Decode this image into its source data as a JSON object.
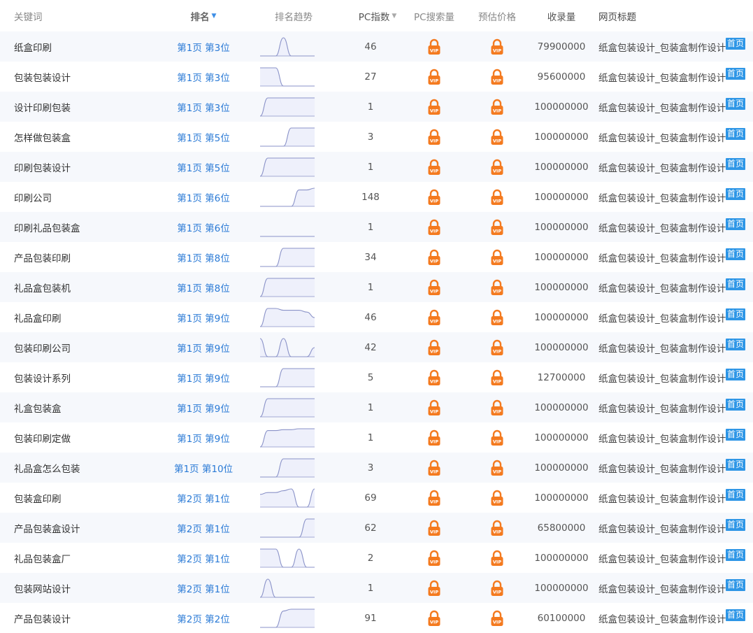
{
  "header": {
    "keyword": "关键词",
    "rank": "排名",
    "trend": "排名趋势",
    "pc_index": "PC指数",
    "pc_search": "PC搜索量",
    "price": "预估价格",
    "indexed": "收录量",
    "page_title": "网页标题"
  },
  "colors": {
    "link": "#2a7ad6",
    "badge": "#2e96e6",
    "trend_line": "#8a92c8",
    "trend_fill": "#eef0fb",
    "lock": "#f47a1f"
  },
  "badge_label": "首页",
  "title_text": "纸盒包装设计_包装盒制作设计",
  "rows": [
    {
      "keyword": "纸盒印刷",
      "rank": "第1页 第3位",
      "pc": "46",
      "indexed": "79900000",
      "trend": [
        0,
        0,
        0,
        1,
        0,
        0,
        0,
        0
      ]
    },
    {
      "keyword": "包装包装设计",
      "rank": "第1页 第3位",
      "pc": "27",
      "indexed": "95600000",
      "trend": [
        1,
        1,
        1,
        0,
        0,
        0,
        0,
        0
      ]
    },
    {
      "keyword": "设计印刷包装",
      "rank": "第1页 第3位",
      "pc": "1",
      "indexed": "100000000",
      "trend": [
        0,
        1,
        1,
        1,
        1,
        1,
        1,
        1
      ]
    },
    {
      "keyword": "怎样做包装盒",
      "rank": "第1页 第5位",
      "pc": "3",
      "indexed": "100000000",
      "trend": [
        0,
        0,
        0,
        0,
        1,
        1,
        1,
        1
      ]
    },
    {
      "keyword": "印刷包装设计",
      "rank": "第1页 第5位",
      "pc": "1",
      "indexed": "100000000",
      "trend": [
        0,
        1,
        1,
        1,
        1,
        1,
        1,
        1
      ]
    },
    {
      "keyword": "印刷公司",
      "rank": "第1页 第6位",
      "pc": "148",
      "indexed": "100000000",
      "trend": [
        0,
        0,
        0,
        0,
        0,
        0.9,
        0.9,
        1
      ]
    },
    {
      "keyword": "印刷礼品包装盒",
      "rank": "第1页 第6位",
      "pc": "1",
      "indexed": "100000000",
      "trend": [
        0,
        0,
        0,
        0,
        0,
        0,
        0,
        0
      ]
    },
    {
      "keyword": "产品包装印刷",
      "rank": "第1页 第8位",
      "pc": "34",
      "indexed": "100000000",
      "trend": [
        0,
        0,
        0,
        1,
        1,
        1,
        1,
        1
      ]
    },
    {
      "keyword": "礼品盒包装机",
      "rank": "第1页 第8位",
      "pc": "1",
      "indexed": "100000000",
      "trend": [
        0,
        1,
        1,
        1,
        1,
        1,
        1,
        1
      ]
    },
    {
      "keyword": "礼品盒印刷",
      "rank": "第1页 第9位",
      "pc": "46",
      "indexed": "100000000",
      "trend": [
        0,
        1,
        1,
        0.9,
        0.9,
        0.9,
        0.8,
        0.5
      ]
    },
    {
      "keyword": "包装印刷公司",
      "rank": "第1页 第9位",
      "pc": "42",
      "indexed": "100000000",
      "trend": [
        1,
        0,
        0,
        1,
        0,
        0,
        0,
        0.5
      ]
    },
    {
      "keyword": "包装设计系列",
      "rank": "第1页 第9位",
      "pc": "5",
      "indexed": "12700000",
      "trend": [
        0,
        0,
        0,
        1,
        1,
        1,
        1,
        1
      ]
    },
    {
      "keyword": "礼盒包装盒",
      "rank": "第1页 第9位",
      "pc": "1",
      "indexed": "100000000",
      "trend": [
        0,
        1,
        1,
        1,
        1,
        1,
        1,
        1
      ]
    },
    {
      "keyword": "包装印刷定做",
      "rank": "第1页 第9位",
      "pc": "1",
      "indexed": "100000000",
      "trend": [
        0,
        0.9,
        0.9,
        0.95,
        0.95,
        1,
        1,
        1
      ]
    },
    {
      "keyword": "礼品盒怎么包装",
      "rank": "第1页 第10位",
      "pc": "3",
      "indexed": "100000000",
      "trend": [
        0,
        0,
        0,
        1,
        1,
        1,
        1,
        1
      ]
    },
    {
      "keyword": "包装盒印刷",
      "rank": "第2页 第1位",
      "pc": "69",
      "indexed": "100000000",
      "trend": [
        0.7,
        0.8,
        0.8,
        0.9,
        1,
        0,
        0,
        1
      ]
    },
    {
      "keyword": "产品包装盒设计",
      "rank": "第2页 第1位",
      "pc": "62",
      "indexed": "65800000",
      "trend": [
        0,
        0,
        0,
        0,
        0,
        0,
        1,
        1
      ]
    },
    {
      "keyword": "礼品包装盒厂",
      "rank": "第2页 第1位",
      "pc": "2",
      "indexed": "100000000",
      "trend": [
        1,
        1,
        1,
        0,
        0,
        1,
        0,
        0
      ]
    },
    {
      "keyword": "包装网站设计",
      "rank": "第2页 第1位",
      "pc": "1",
      "indexed": "100000000",
      "trend": [
        0,
        1,
        0,
        0,
        0,
        0,
        0,
        0
      ]
    },
    {
      "keyword": "产品包装设计",
      "rank": "第2页 第2位",
      "pc": "91",
      "indexed": "60100000",
      "trend": [
        0,
        0,
        0,
        0.9,
        1,
        1,
        1,
        1
      ]
    }
  ]
}
